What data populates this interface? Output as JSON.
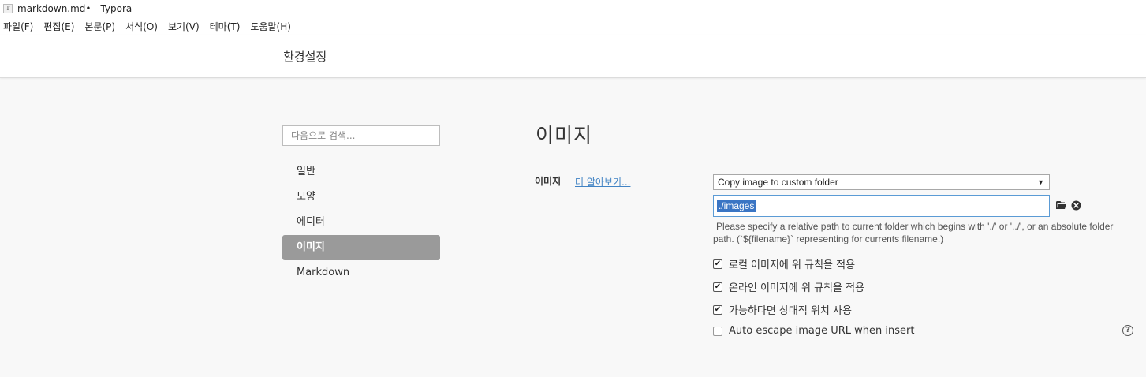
{
  "window": {
    "icon_letter": "T",
    "title": "markdown.md• - Typora"
  },
  "menu": [
    {
      "label": "파일(F)"
    },
    {
      "label": "편집(E)"
    },
    {
      "label": "본문(P)"
    },
    {
      "label": "서식(O)"
    },
    {
      "label": "보기(V)"
    },
    {
      "label": "테마(T)"
    },
    {
      "label": "도움말(H)"
    }
  ],
  "header": {
    "title": "환경설정"
  },
  "sidebar": {
    "search_placeholder": "다음으로 검색...",
    "items": [
      {
        "label": "일반"
      },
      {
        "label": "모양"
      },
      {
        "label": "에디터"
      },
      {
        "label": "이미지"
      },
      {
        "label": "Markdown"
      }
    ],
    "active_index": 3
  },
  "main": {
    "section_title": "이미지",
    "image_label": "이미지",
    "learn_more": "더 알아보기...",
    "insert_action": {
      "selected": "Copy image to custom folder",
      "arrow": "▼"
    },
    "folder_path": "./images",
    "hint": "Please specify a relative path to current folder which begins with './' or '../', or an absolute folder path. (`${filename}` representing for currents filename.)",
    "options": [
      {
        "label": "로컬 이미지에 위 규칙을 적용",
        "checked": true
      },
      {
        "label": "온라인 이미지에 위 규칙을 적용",
        "checked": true
      },
      {
        "label": "가능하다면 상대적 위치 사용",
        "checked": true
      },
      {
        "label": "Auto escape image URL when insert",
        "checked": false
      }
    ],
    "help_glyph": "?"
  },
  "colors": {
    "active_nav_bg": "#9a9a9a",
    "link": "#4183c4",
    "selection": "#3a75c4",
    "input_focus_border": "#5b9bd5"
  }
}
